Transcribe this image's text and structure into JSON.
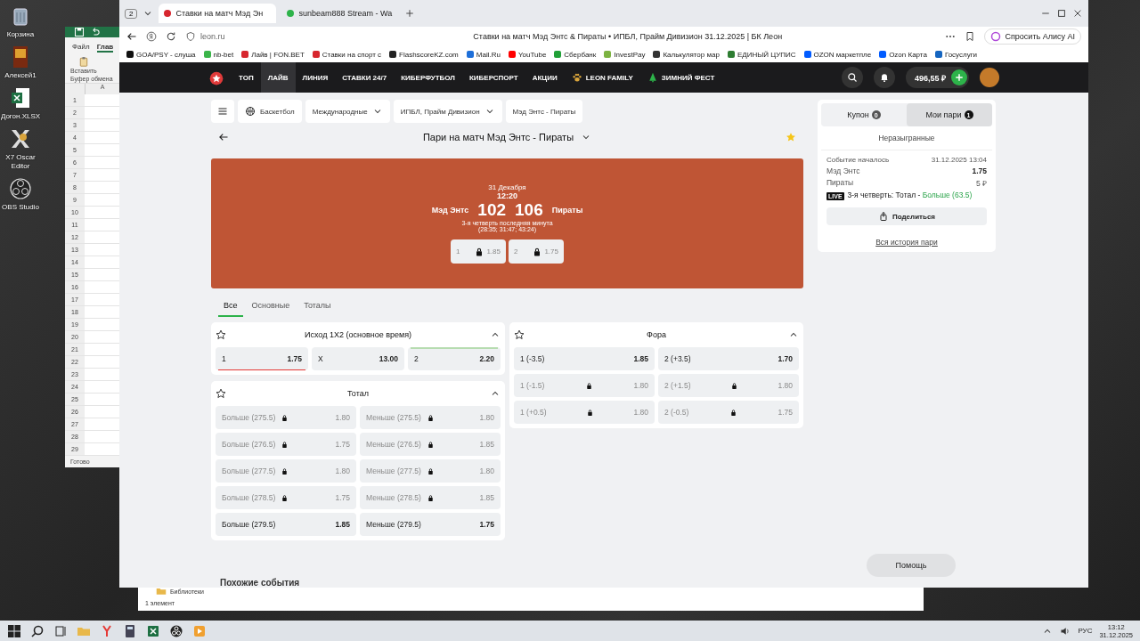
{
  "desktop_icons": [
    {
      "label": "Корзина",
      "kind": "bin"
    },
    {
      "label": "Алексей1",
      "kind": "poster"
    },
    {
      "label": "Догон.XLSX",
      "kind": "excel"
    },
    {
      "label": "X7 Oscar Editor",
      "kind": "x7"
    },
    {
      "label": "OBS Studio",
      "kind": "obs"
    }
  ],
  "excel": {
    "tabs": [
      {
        "label": "Файл",
        "selected": false
      },
      {
        "label": "Глав",
        "selected": true
      }
    ],
    "paste": "Вставить",
    "group": "Буфер обмена",
    "column": "A",
    "rows": [
      "1",
      "2",
      "3",
      "4",
      "5",
      "6",
      "7",
      "8",
      "9",
      "10",
      "11",
      "12",
      "13",
      "14",
      "15",
      "16",
      "17",
      "18",
      "19",
      "20",
      "21",
      "22",
      "23",
      "24",
      "25",
      "26",
      "27",
      "28",
      "29"
    ],
    "status": "Готово"
  },
  "browser": {
    "tab_count": "2",
    "tabs": [
      {
        "title": "Ставки на матч Мэд Эн",
        "selected": true
      },
      {
        "title": "sunbeam888 Stream - Wa",
        "selected": false
      }
    ],
    "address": "leon.ru",
    "page_title": "Ставки на матч Мэд Энтс & Пираты • ИПБЛ, Прайм Дивизион 31.12.2025 | БК Леон",
    "alice": "Спросить Алису AI",
    "bookmarks": [
      {
        "label": "GOA/PSY - слуша",
        "color": "#111111"
      },
      {
        "label": "nb-bet",
        "color": "#3bb54a"
      },
      {
        "label": "Лайв | FON.BET",
        "color": "#d7262e"
      },
      {
        "label": "Ставки на спорт с",
        "color": "#d7262e"
      },
      {
        "label": "FlashscoreKZ.com",
        "color": "#222222"
      },
      {
        "label": "Mail.Ru",
        "color": "#1e6fd9"
      },
      {
        "label": "YouTube",
        "color": "#ff0000"
      },
      {
        "label": "Сбербанк",
        "color": "#21a038"
      },
      {
        "label": "InvestPay",
        "color": "#7cb342"
      },
      {
        "label": "Калькулятор мар",
        "color": "#333333"
      },
      {
        "label": "ЕДИНЫЙ ЦУПИС",
        "color": "#2e7d32"
      },
      {
        "label": "OZON маркетпле",
        "color": "#005bff"
      },
      {
        "label": "Ozon Карта",
        "color": "#005bff"
      },
      {
        "label": "Госуслуги",
        "color": "#1565c0"
      }
    ]
  },
  "site": {
    "nav": [
      {
        "label": "ТОП",
        "selected": false,
        "kind": "text"
      },
      {
        "label": "ЛАЙВ",
        "selected": true,
        "kind": "text"
      },
      {
        "label": "ЛИНИЯ",
        "selected": false,
        "kind": "text"
      },
      {
        "label": "СТАВКИ 24/7",
        "selected": false,
        "kind": "text"
      },
      {
        "label": "КИБЕРФУТБОЛ",
        "selected": false,
        "kind": "text"
      },
      {
        "label": "КИБЕРСПОРТ",
        "selected": false,
        "kind": "text"
      },
      {
        "label": "АКЦИИ",
        "selected": false,
        "kind": "text"
      },
      {
        "label": "LEON FAMILY",
        "selected": false,
        "kind": "paw"
      },
      {
        "label": "ЗИМНИЙ ФЕСТ",
        "selected": false,
        "kind": "tree"
      }
    ],
    "balance": "496,55 ₽",
    "breadcrumbs": [
      {
        "label": "Баскетбол",
        "kind": "sport"
      },
      {
        "label": "Международные",
        "kind": "dropdown"
      },
      {
        "label": "ИПБЛ, Прайм Дивизион",
        "kind": "dropdown"
      },
      {
        "label": "Мэд Энтс - Пираты",
        "kind": "plain"
      }
    ],
    "title": "Пари на матч Мэд Энтс - Пираты",
    "scoreboard": {
      "date": "31 Декабря",
      "time": "12:20",
      "home": "Мэд Энтс",
      "away": "Пираты",
      "score_home": "102",
      "score_away": "106",
      "period": "3-я четверть последняя минута",
      "quarters": "(28:35; 31:47; 43:24)",
      "odds": [
        {
          "label": "1",
          "odd": "1.85",
          "locked": true
        },
        {
          "label": "2",
          "odd": "1.75",
          "locked": true
        }
      ]
    },
    "market_tabs": [
      {
        "label": "Все",
        "selected": true
      },
      {
        "label": "Основные",
        "selected": false
      },
      {
        "label": "Тоталы",
        "selected": false
      }
    ],
    "market_columns": [
      {
        "markets": [
          {
            "kind": "three_way",
            "title": "Исход 1X2 (основное время)",
            "outcomes": [
              {
                "label": "1",
                "odd": "1.75",
                "locked": false,
                "odds_fell": true,
                "odds_rose": false
              },
              {
                "label": "X",
                "odd": "13.00",
                "locked": false,
                "odds_fell": false,
                "odds_rose": false
              },
              {
                "label": "2",
                "odd": "2.20",
                "locked": false,
                "odds_fell": false,
                "odds_rose": true
              }
            ]
          },
          {
            "kind": "two_way",
            "title": "Тотал",
            "outcomes": [
              {
                "label": "Больше (275.5)",
                "odd": "1.80",
                "locked": true,
                "odds_fell": false,
                "odds_rose": false
              },
              {
                "label": "Меньше (275.5)",
                "odd": "1.80",
                "locked": true,
                "odds_fell": false,
                "odds_rose": false
              },
              {
                "label": "Больше (276.5)",
                "odd": "1.75",
                "locked": true,
                "odds_fell": false,
                "odds_rose": false
              },
              {
                "label": "Меньше (276.5)",
                "odd": "1.85",
                "locked": true,
                "odds_fell": false,
                "odds_rose": false
              },
              {
                "label": "Больше (277.5)",
                "odd": "1.80",
                "locked": true,
                "odds_fell": false,
                "odds_rose": false
              },
              {
                "label": "Меньше (277.5)",
                "odd": "1.80",
                "locked": true,
                "odds_fell": false,
                "odds_rose": false
              },
              {
                "label": "Больше (278.5)",
                "odd": "1.75",
                "locked": true,
                "odds_fell": false,
                "odds_rose": false
              },
              {
                "label": "Меньше (278.5)",
                "odd": "1.85",
                "locked": true,
                "odds_fell": false,
                "odds_rose": false
              },
              {
                "label": "Больше (279.5)",
                "odd": "1.85",
                "locked": false,
                "odds_fell": false,
                "odds_rose": false
              },
              {
                "label": "Меньше (279.5)",
                "odd": "1.75",
                "locked": false,
                "odds_fell": false,
                "odds_rose": false
              }
            ]
          }
        ]
      },
      {
        "markets": [
          {
            "kind": "two_way_centered",
            "title": "Фора",
            "outcomes": [
              {
                "label": "1 (-3.5)",
                "odd": "1.85",
                "locked": false,
                "odds_fell": false,
                "odds_rose": false
              },
              {
                "label": "2 (+3.5)",
                "odd": "1.70",
                "locked": false,
                "odds_fell": false,
                "odds_rose": false
              },
              {
                "label": "1 (-1.5)",
                "odd": "1.80",
                "locked": true,
                "odds_fell": false,
                "odds_rose": false
              },
              {
                "label": "2 (+1.5)",
                "odd": "1.80",
                "locked": true,
                "odds_fell": false,
                "odds_rose": false
              },
              {
                "label": "1 (+0.5)",
                "odd": "1.80",
                "locked": true,
                "odds_fell": false,
                "odds_rose": false
              },
              {
                "label": "2 (-0.5)",
                "odd": "1.75",
                "locked": true,
                "odds_fell": false,
                "odds_rose": false
              }
            ]
          }
        ]
      }
    ],
    "similar": "Похожие события",
    "betslip": {
      "tabs": [
        {
          "label": "Купон",
          "count": "0",
          "selected": false
        },
        {
          "label": "Мои пари",
          "count": "1",
          "selected": true
        }
      ],
      "section": "Неразыгранные",
      "status": "Событие началось",
      "datetime": "31.12.2025 13:04",
      "home": "Мэд Энтс",
      "odd": "1.75",
      "away": "Пираты",
      "stake": "5 ₽",
      "live": "LIVE",
      "market": "3-я четверть: Тотал - ",
      "pick": "Больше (63.5)",
      "share": "Поделиться",
      "history": "Вся история пари"
    },
    "help": "Помощь"
  },
  "explorer": {
    "folder": "Библиотеки",
    "count": "1 элемент"
  },
  "taskbar": {
    "apps": [
      {
        "kind": "start"
      },
      {
        "kind": "search"
      },
      {
        "kind": "taskview"
      },
      {
        "kind": "explorer"
      },
      {
        "kind": "yandex"
      },
      {
        "kind": "calculator"
      },
      {
        "kind": "excel"
      },
      {
        "kind": "obs"
      },
      {
        "kind": "player"
      }
    ],
    "language": "РУС",
    "time": "13:12",
    "date": "31.12.2025"
  }
}
